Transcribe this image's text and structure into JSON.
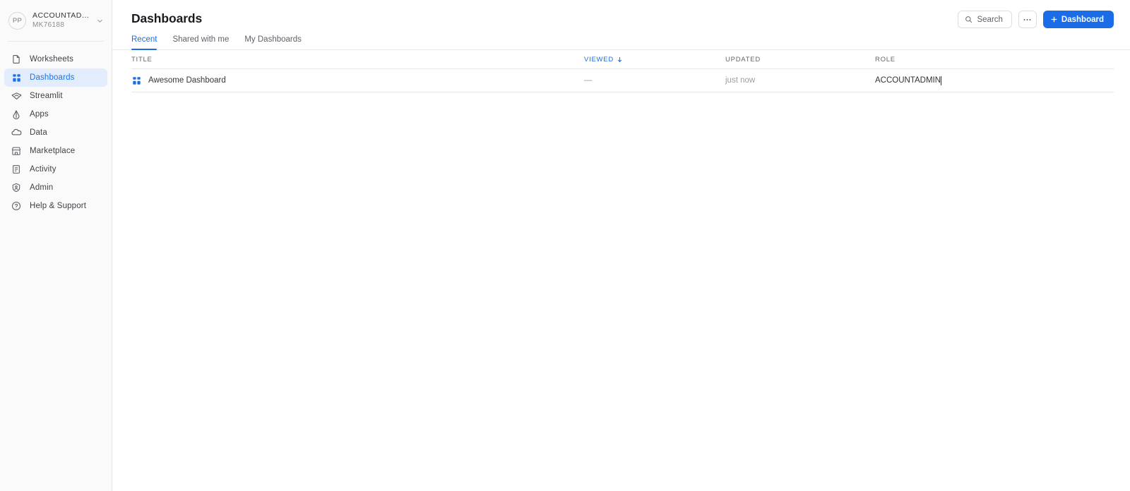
{
  "sidebar": {
    "account": {
      "avatar_initials": "PP",
      "role": "ACCOUNTADMIN",
      "org": "MK76188",
      "chevron_icon": "chevron-down-icon"
    },
    "items": [
      {
        "label": "Worksheets",
        "icon": "document-icon",
        "active": false
      },
      {
        "label": "Dashboards",
        "icon": "grid-icon",
        "active": true
      },
      {
        "label": "Streamlit",
        "icon": "streamlit-icon",
        "active": false
      },
      {
        "label": "Apps",
        "icon": "apps-icon",
        "active": false
      },
      {
        "label": "Data",
        "icon": "cloud-icon",
        "active": false
      },
      {
        "label": "Marketplace",
        "icon": "storefront-icon",
        "active": false
      },
      {
        "label": "Activity",
        "icon": "activity-icon",
        "active": false
      },
      {
        "label": "Admin",
        "icon": "shield-user-icon",
        "active": false
      },
      {
        "label": "Help & Support",
        "icon": "help-circle-icon",
        "active": false
      }
    ]
  },
  "header": {
    "title": "Dashboards",
    "search_label": "Search",
    "search_icon": "search-icon",
    "more_label": "•••",
    "more_icon": "ellipsis-icon",
    "new_dashboard_label": "Dashboard",
    "new_dashboard_plus": "+"
  },
  "tabs": [
    {
      "label": "Recent",
      "active": true
    },
    {
      "label": "Shared with me",
      "active": false
    },
    {
      "label": "My Dashboards",
      "active": false
    }
  ],
  "table": {
    "columns": [
      {
        "key": "title",
        "label": "TITLE",
        "sorted": false
      },
      {
        "key": "viewed",
        "label": "VIEWED",
        "sorted": true,
        "sort_icon": "arrow-down-icon"
      },
      {
        "key": "updated",
        "label": "UPDATED",
        "sorted": false
      },
      {
        "key": "role",
        "label": "ROLE",
        "sorted": false
      }
    ],
    "rows": [
      {
        "icon": "grid-icon",
        "title": "Awesome Dashboard",
        "viewed": "—",
        "updated": "just now",
        "role": "ACCOUNTADMIN"
      }
    ]
  },
  "colors": {
    "accent": "#1a6ce7",
    "accent_soft": "#e3ecfd",
    "sidebar_bg": "#fafafa",
    "border": "#e6e7e9",
    "text": "#33363b",
    "muted": "#9a9da3"
  }
}
